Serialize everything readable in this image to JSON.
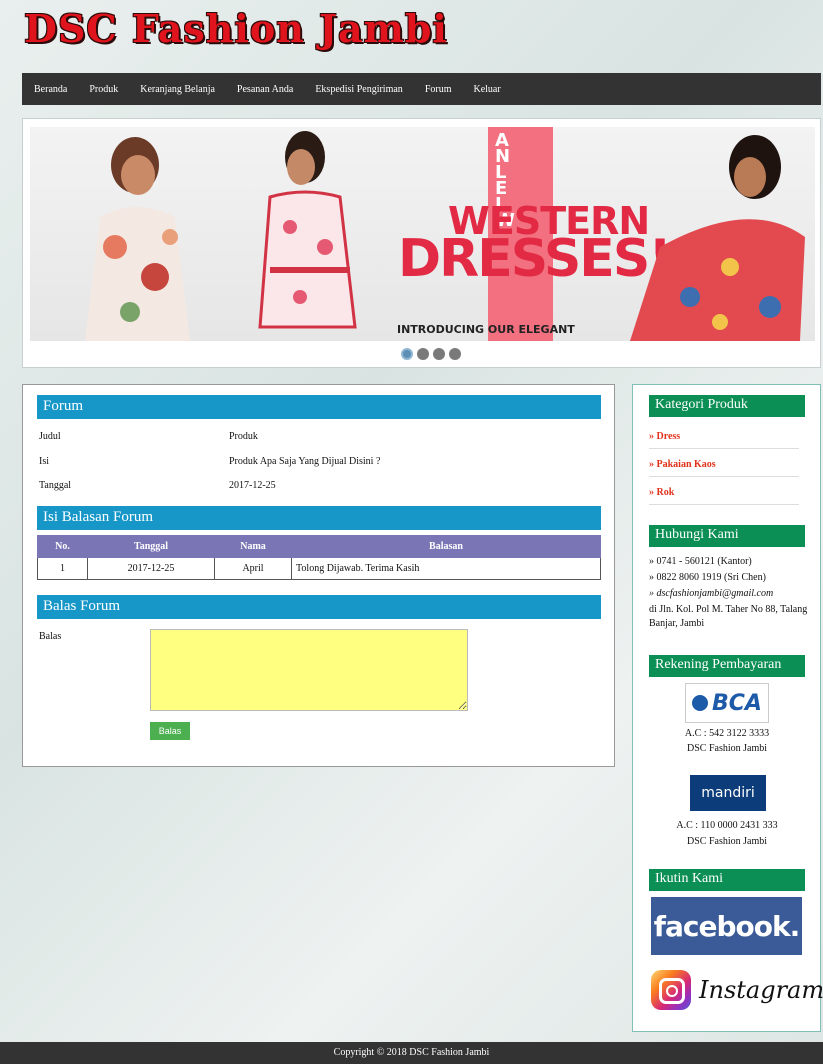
{
  "site": {
    "title": "DSC Fashion Jambi"
  },
  "nav": [
    "Beranda",
    "Produk",
    "Keranjang Belanja",
    "Pesanan Anda",
    "Ekspedisi Pengiriman",
    "Forum",
    "Keluar"
  ],
  "banner": {
    "letters": [
      "A",
      "N",
      "L",
      "E",
      "L",
      "W"
    ],
    "line1": "WESTERN",
    "line2": "DRESSES!",
    "tagline": "INTRODUCING OUR ELEGANT",
    "slides": 4,
    "active_slide": 1
  },
  "forum": {
    "heading": "Forum",
    "fields": [
      {
        "label": "Judul",
        "value": "Produk"
      },
      {
        "label": "Isi",
        "value": "Produk Apa Saja Yang Dijual Disini ?"
      },
      {
        "label": "Tanggal",
        "value": "2017-12-25"
      }
    ]
  },
  "replies": {
    "heading": "Isi Balasan Forum",
    "columns": [
      "No.",
      "Tanggal",
      "Nama",
      "Balasan"
    ],
    "rows": [
      {
        "no": "1",
        "tanggal": "2017-12-25",
        "nama": "April",
        "balasan": "Tolong Dijawab. Terima Kasih"
      }
    ]
  },
  "reply_form": {
    "heading": "Balas Forum",
    "label": "Balas",
    "value": "",
    "button": "Balas",
    "textarea_color": "#ffff80"
  },
  "sidebar": {
    "categories_heading": "Kategori Produk",
    "categories": [
      "» Dress",
      "» Pakaian Kaos",
      "» Rok"
    ],
    "contact_heading": "Hubungi Kami",
    "contact": [
      "» 0741 - 560121 (Kantor)",
      "» 0822 8060 1919 (Sri Chen)",
      "» dscfashionjambi@gmail.com",
      "di Jln. Kol. Pol M. Taher No 88, Talang Banjar, Jambi"
    ],
    "payment_heading": "Rekening Pembayaran",
    "banks": [
      {
        "name": "BCA",
        "account": "A.C : 542 3122 3333",
        "holder": "DSC Fashion Jambi"
      },
      {
        "name": "mandiri",
        "account": "A.C : 110 0000 2431 333",
        "holder": "DSC Fashion Jambi"
      }
    ],
    "follow_heading": "Ikutin Kami",
    "facebook": "facebook.",
    "instagram": "Instagram"
  },
  "footer": "Copyright © 2018 DSC Fashion Jambi",
  "colors": {
    "title_red": "#e0141c",
    "nav_bg": "#333333",
    "blue_bar": "#1797c8",
    "green_bar": "#0c8f55",
    "table_header": "#7a76b6",
    "button_green": "#4caf50"
  }
}
